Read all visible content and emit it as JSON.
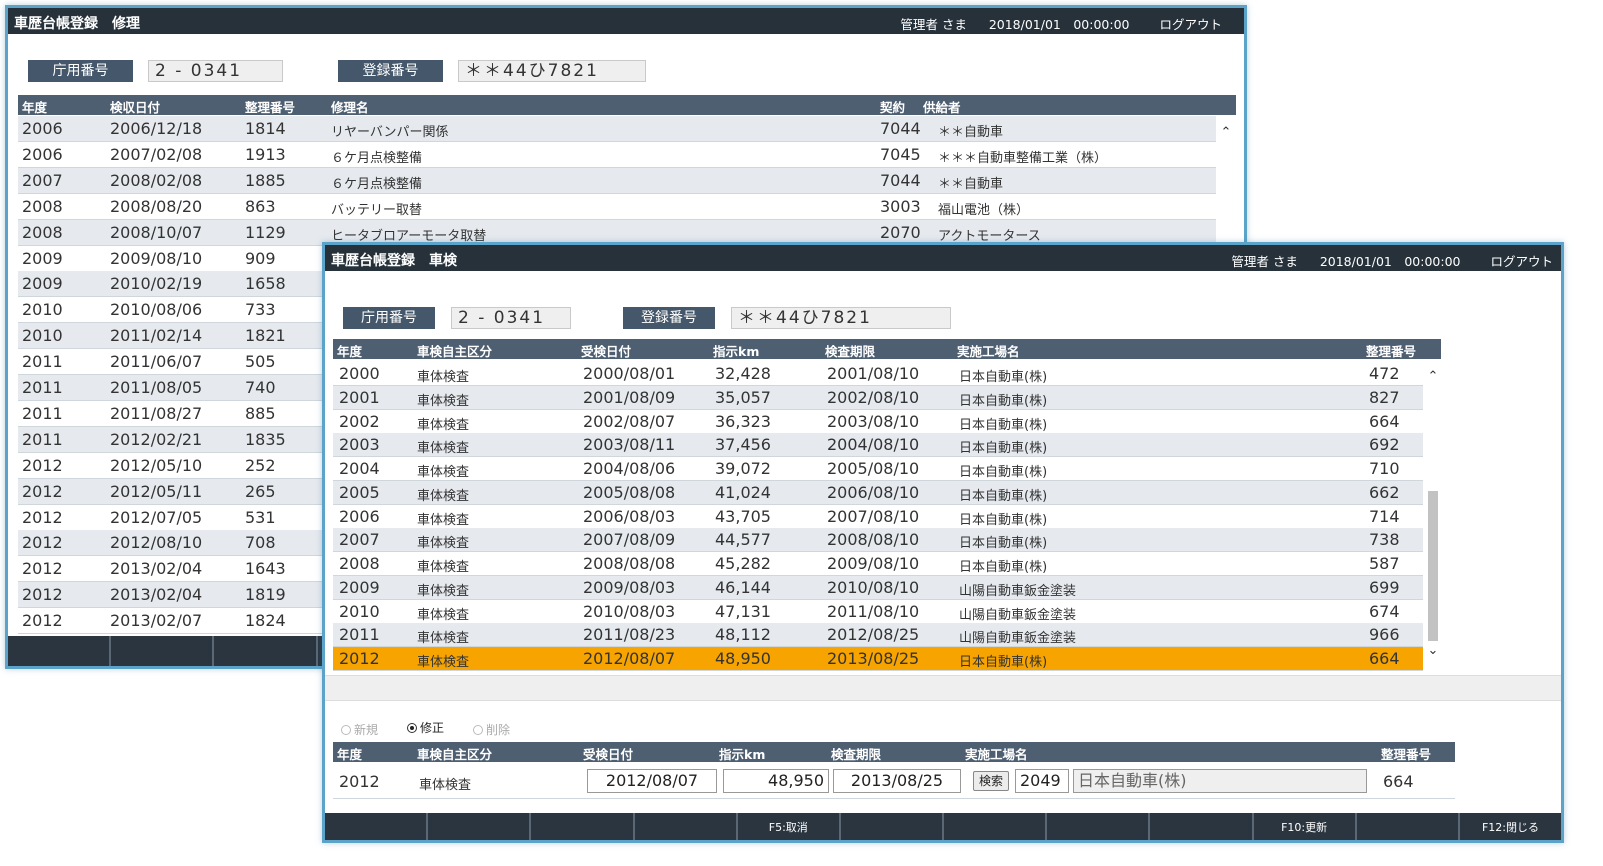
{
  "repair": {
    "title": "車歴台帳登録　修理",
    "user": "管理者 さま",
    "datetime": "2018/01/01　00:00:00",
    "logout": "ログアウト",
    "office_label": "庁用番号",
    "office_value": "2 - 0341",
    "reg_label": "登録番号",
    "reg_value": "＊＊44ひ7821",
    "columns": [
      "年度",
      "検収日付",
      "整理番号",
      "修理名",
      "契約",
      "供給者"
    ],
    "rows": [
      [
        "2006",
        "2006/12/18",
        "1814",
        "リヤーバンパー関係",
        "7044",
        "＊＊自動車"
      ],
      [
        "2006",
        "2007/02/08",
        "1913",
        "６ケ月点検整備",
        "7045",
        "＊＊＊自動車整備工業（株）"
      ],
      [
        "2007",
        "2008/02/08",
        "1885",
        "６ケ月点検整備",
        "7044",
        "＊＊自動車"
      ],
      [
        "2008",
        "2008/08/20",
        "863",
        "バッテリー取替",
        "3003",
        "福山電池（株）"
      ],
      [
        "2008",
        "2008/10/07",
        "1129",
        "ヒータブロアーモータ取替",
        "2070",
        "アクトモータース"
      ],
      [
        "2009",
        "2009/08/10",
        "909",
        "",
        "",
        ""
      ],
      [
        "2009",
        "2010/02/19",
        "1658",
        "",
        "",
        ""
      ],
      [
        "2010",
        "2010/08/06",
        "733",
        "",
        "",
        ""
      ],
      [
        "2010",
        "2011/02/14",
        "1821",
        "",
        "",
        ""
      ],
      [
        "2011",
        "2011/06/07",
        "505",
        "",
        "",
        ""
      ],
      [
        "2011",
        "2011/08/05",
        "740",
        "",
        "",
        ""
      ],
      [
        "2011",
        "2011/08/27",
        "885",
        "",
        "",
        ""
      ],
      [
        "2011",
        "2012/02/21",
        "1835",
        "",
        "",
        ""
      ],
      [
        "2012",
        "2012/05/10",
        "252",
        "",
        "",
        ""
      ],
      [
        "2012",
        "2012/05/11",
        "265",
        "",
        "",
        ""
      ],
      [
        "2012",
        "2012/07/05",
        "531",
        "",
        "",
        ""
      ],
      [
        "2012",
        "2012/08/10",
        "708",
        "",
        "",
        ""
      ],
      [
        "2012",
        "2013/02/04",
        "1643",
        "",
        "",
        ""
      ],
      [
        "2012",
        "2013/02/04",
        "1819",
        "",
        "",
        ""
      ],
      [
        "2012",
        "2013/02/07",
        "1824",
        "",
        "",
        ""
      ]
    ]
  },
  "inspection": {
    "title": "車歴台帳登録　車検",
    "user": "管理者 さま",
    "datetime": "2018/01/01　00:00:00",
    "logout": "ログアウト",
    "office_label": "庁用番号",
    "office_value": "2 - 0341",
    "reg_label": "登録番号",
    "reg_value": "＊＊44ひ7821",
    "columns": [
      "年度",
      "車検自主区分",
      "受検日付",
      "指示km",
      "検査期限",
      "実施工場名",
      "整理番号"
    ],
    "rows": [
      [
        "2000",
        "車体検査",
        "2000/08/01",
        "32,428",
        "2001/08/10",
        "日本自動車(株)",
        "472"
      ],
      [
        "2001",
        "車体検査",
        "2001/08/09",
        "35,057",
        "2002/08/10",
        "日本自動車(株)",
        "827"
      ],
      [
        "2002",
        "車体検査",
        "2002/08/07",
        "36,323",
        "2003/08/10",
        "日本自動車(株)",
        "664"
      ],
      [
        "2003",
        "車体検査",
        "2003/08/11",
        "37,456",
        "2004/08/10",
        "日本自動車(株)",
        "692"
      ],
      [
        "2004",
        "車体検査",
        "2004/08/06",
        "39,072",
        "2005/08/10",
        "日本自動車(株)",
        "710"
      ],
      [
        "2005",
        "車体検査",
        "2005/08/08",
        "41,024",
        "2006/08/10",
        "日本自動車(株)",
        "662"
      ],
      [
        "2006",
        "車体検査",
        "2006/08/03",
        "43,705",
        "2007/08/10",
        "日本自動車(株)",
        "714"
      ],
      [
        "2007",
        "車体検査",
        "2007/08/09",
        "44,577",
        "2008/08/10",
        "日本自動車(株)",
        "738"
      ],
      [
        "2008",
        "車体検査",
        "2008/08/08",
        "45,282",
        "2009/08/10",
        "日本自動車(株)",
        "587"
      ],
      [
        "2009",
        "車体検査",
        "2009/08/03",
        "46,144",
        "2010/08/10",
        "山陽自動車鈑金塗装",
        "699"
      ],
      [
        "2010",
        "車体検査",
        "2010/08/03",
        "47,131",
        "2011/08/10",
        "山陽自動車鈑金塗装",
        "674"
      ],
      [
        "2011",
        "車体検査",
        "2011/08/23",
        "48,112",
        "2012/08/25",
        "山陽自動車鈑金塗装",
        "966"
      ],
      [
        "2012",
        "車体検査",
        "2012/08/07",
        "48,950",
        "2013/08/25",
        "日本自動車(株)",
        "664"
      ]
    ],
    "selected_index": 12,
    "radios": [
      {
        "label": "新規",
        "checked": false
      },
      {
        "label": "修正",
        "checked": true
      },
      {
        "label": "削除",
        "checked": false
      }
    ],
    "form": {
      "year": "2012",
      "category": "車体検査",
      "date": "2012/08/07",
      "km": "48,950",
      "expiry": "2013/08/25",
      "search_button": "検索",
      "factory_code": "2049",
      "factory_name": "日本自動車(株)",
      "ref_no": "664"
    },
    "fkeys": [
      "",
      "",
      "",
      "",
      "F5:取消",
      "",
      "",
      "",
      "",
      "F10:更新",
      "",
      "F12:閉じる"
    ]
  },
  "colors": {
    "titlebar": "#26313a",
    "header": "#4e5f72",
    "label_box": "#45576a",
    "selected_row": "#f7a400",
    "border": "#5ba3c9"
  }
}
